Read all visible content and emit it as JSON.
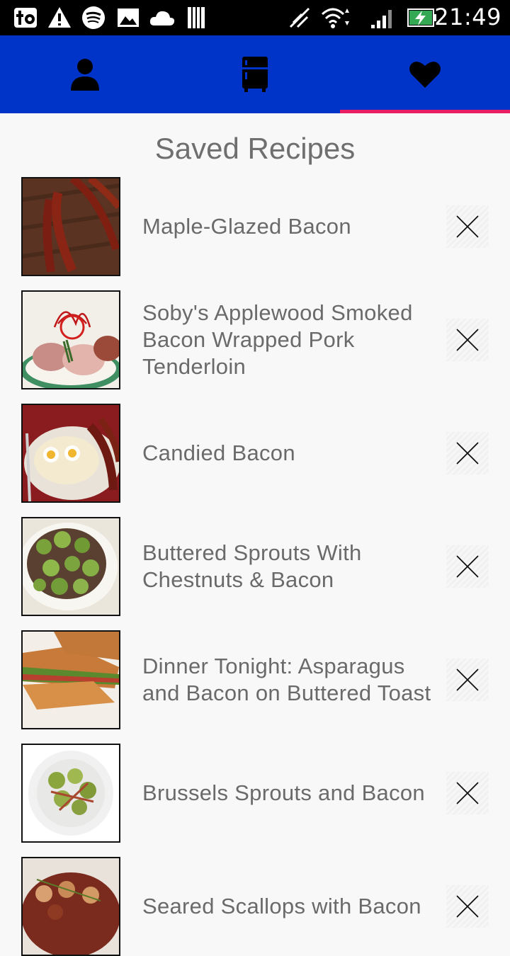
{
  "status_bar": {
    "time": "21:49"
  },
  "tabs": [
    {
      "name": "profile",
      "icon": "person-icon"
    },
    {
      "name": "fridge",
      "icon": "fridge-icon"
    },
    {
      "name": "saved",
      "icon": "heart-icon",
      "selected": true
    }
  ],
  "colors": {
    "toolbar": "#0034c8",
    "indicator": "#e91e63",
    "background": "#f8f8f8"
  },
  "page": {
    "title": "Saved Recipes"
  },
  "recipes": [
    {
      "title": "Maple-Glazed Bacon",
      "remove_icon": "close-icon"
    },
    {
      "title": "Soby's Applewood Smoked Bacon Wrapped Pork Tenderloin",
      "remove_icon": "close-icon"
    },
    {
      "title": "Candied Bacon",
      "remove_icon": "close-icon"
    },
    {
      "title": "Buttered Sprouts With Chestnuts & Bacon",
      "remove_icon": "close-icon"
    },
    {
      "title": "Dinner Tonight: Asparagus and Bacon on Buttered Toast",
      "remove_icon": "close-icon"
    },
    {
      "title": "Brussels Sprouts and Bacon",
      "remove_icon": "close-icon"
    },
    {
      "title": "Seared Scallops with Bacon",
      "remove_icon": "close-icon"
    }
  ]
}
